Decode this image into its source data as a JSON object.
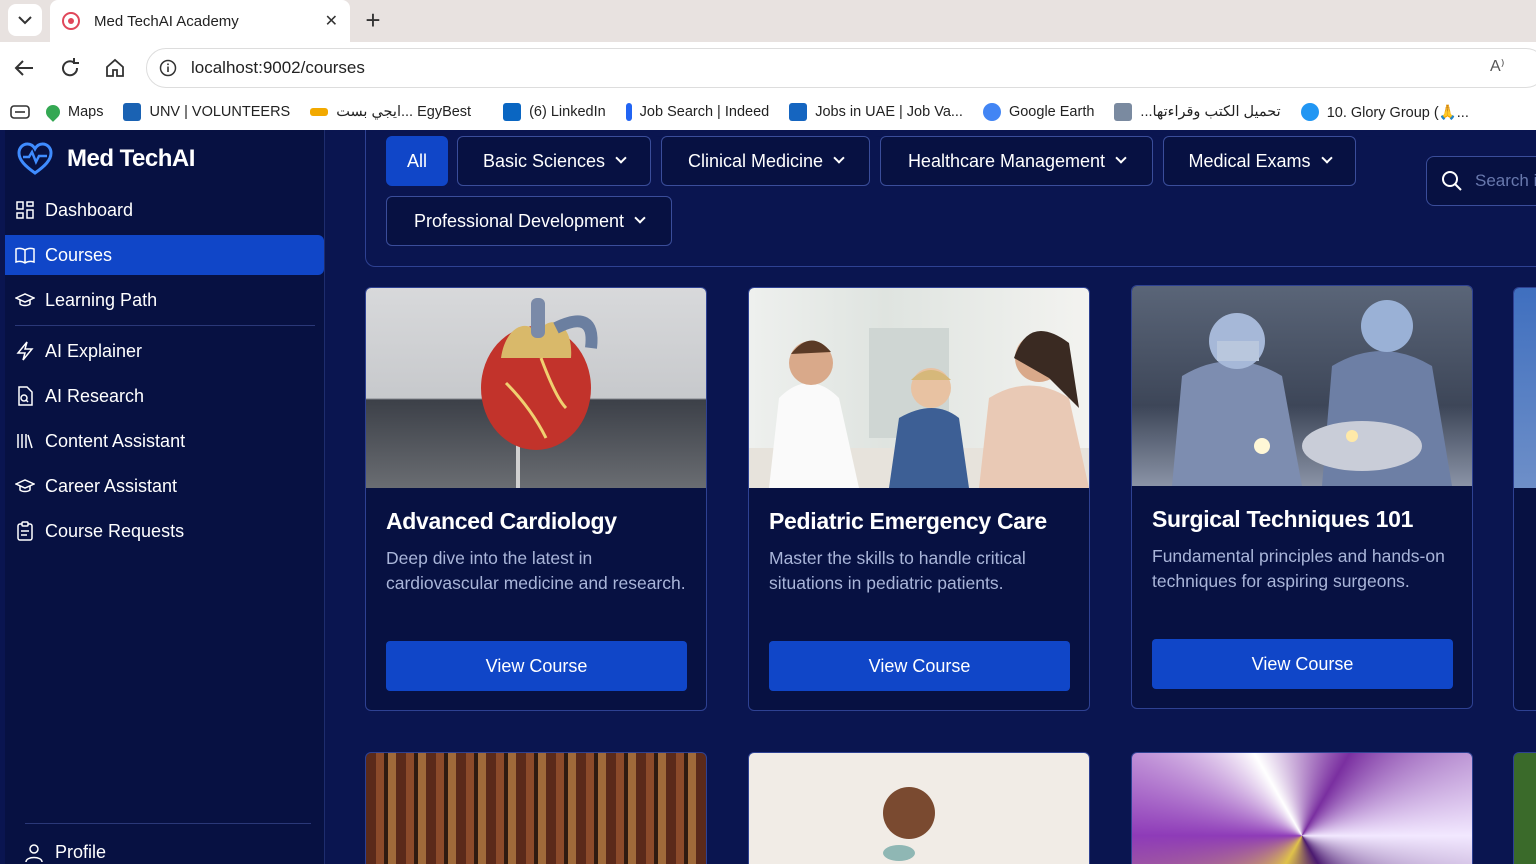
{
  "browser": {
    "tab_title": "Med TechAI Academy",
    "new_tab_symbol": "+",
    "close_symbol": "✕",
    "url": "localhost:9002/courses",
    "read_aloud": "A⁾",
    "bookmarks": [
      {
        "label": "Maps",
        "color": "#34a853"
      },
      {
        "label": "UNV | VOLUNTEERS",
        "color": "#1a62b3"
      },
      {
        "label": "ايجي بست... EgyBest",
        "color": "#f2a900"
      },
      {
        "label": "(6) LinkedIn",
        "color": "#0a66c2"
      },
      {
        "label": "Job Search | Indeed",
        "color": "#2164f3"
      },
      {
        "label": "Jobs in UAE | Job Va...",
        "color": "#1565c0"
      },
      {
        "label": "Google Earth",
        "color": "#4285f4"
      },
      {
        "label": "تحميل الكتب وقراءتها...",
        "color": "#7a8aa0"
      },
      {
        "label": "10. Glory Group (🙏...",
        "color": "#2196f3"
      }
    ]
  },
  "app": {
    "brand": "Med TechAI",
    "nav": [
      {
        "label": "Dashboard",
        "icon": "grid-icon",
        "active": false
      },
      {
        "label": "Courses",
        "icon": "book-open-icon",
        "active": true
      },
      {
        "label": "Learning Path",
        "icon": "graduation-cap-icon",
        "active": false
      },
      {
        "label": "AI Explainer",
        "icon": "bolt-icon",
        "active": false
      },
      {
        "label": "AI Research",
        "icon": "document-search-icon",
        "active": false
      },
      {
        "label": "Content Assistant",
        "icon": "library-icon",
        "active": false
      },
      {
        "label": "Career Assistant",
        "icon": "graduation-cap-icon",
        "active": false
      },
      {
        "label": "Course Requests",
        "icon": "clipboard-icon",
        "active": false
      }
    ],
    "profile_label": "Profile",
    "accent": "#1046c8"
  },
  "filters": {
    "chips": [
      "All",
      "Basic Sciences",
      "Clinical Medicine",
      "Healthcare Management",
      "Medical Exams",
      "Professional Development"
    ],
    "active": "All",
    "search_placeholder": "Search in All"
  },
  "courses": [
    {
      "title": "Advanced Cardiology",
      "description": "Deep dive into the latest in cardiovascular medicine and research.",
      "button": "View Course"
    },
    {
      "title": "Pediatric Emergency Care",
      "description": "Master the skills to handle critical situations in pediatric patients.",
      "button": "View Course"
    },
    {
      "title": "Surgical Techniques 101",
      "description": "Fundamental principles and hands-on techniques for aspiring surgeons.",
      "button": "View Course"
    }
  ]
}
